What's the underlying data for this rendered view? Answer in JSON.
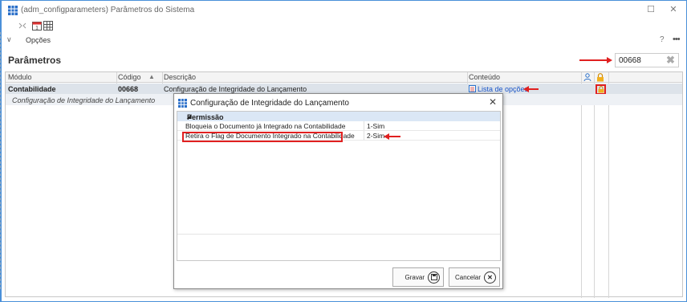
{
  "window": {
    "title": "(adm_configparameters)  Parâmetros do Sistema",
    "minimize_glyph": "☐",
    "close_glyph": "✕"
  },
  "ribbon": {
    "section_label": "Opções",
    "help": "?",
    "more": "•••"
  },
  "main": {
    "title": "Parâmetros",
    "search_value": "00668"
  },
  "grid": {
    "columns": [
      "Módulo",
      "Código",
      "Descrição",
      "Conteúdo"
    ],
    "rows": [
      {
        "modulo": "Contabilidade",
        "codigo": "00668",
        "descricao": "Configuração de Integridade do Lançamento",
        "conteudo": "Lista de opções"
      }
    ],
    "detail_text": "Configuração de Integridade do Lançamento"
  },
  "dialog": {
    "title": "Configuração de Integridade do Lançamento",
    "close": "✕",
    "group": "Permissão",
    "items": [
      {
        "label": "Bloqueia o  Documento já Integrado na Contabilidade",
        "value": "1-Sim"
      },
      {
        "label": "Retira o Flag de  Documento Integrado na Contabilidade",
        "value": "2-Sim"
      }
    ],
    "save_label": "Gravar",
    "cancel_label": "Cancelar"
  },
  "colors": {
    "accent": "#e02020",
    "link": "#1a55c8",
    "group_header": "#dbe7f5"
  },
  "icons": [
    "app-grid-icon",
    "sort-icon",
    "calendar-icon",
    "table-icon",
    "chevron-down-icon",
    "search-clear-icon",
    "person-icon",
    "lock-icon",
    "list-icon",
    "save-icon",
    "cancel-icon"
  ]
}
